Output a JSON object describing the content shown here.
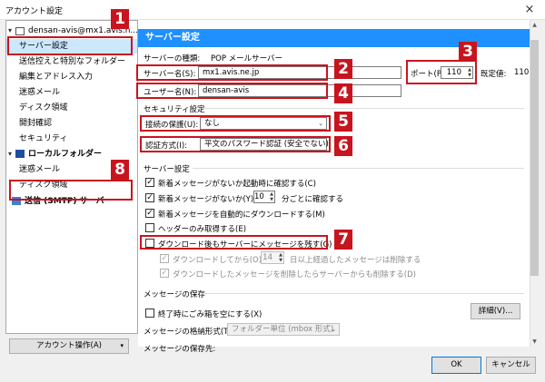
{
  "window": {
    "title": "アカウント設定",
    "close_icon": "×"
  },
  "tree": {
    "items": [
      {
        "label": "densan-avis@mx1.avis.n..."
      },
      {
        "label": "サーバー設定"
      },
      {
        "label": "送信控えと特別なフォルダー"
      },
      {
        "label": "編集とアドレス入力"
      },
      {
        "label": "迷惑メール"
      },
      {
        "label": "ディスク領域"
      },
      {
        "label": "開封確認"
      },
      {
        "label": "セキュリティ"
      },
      {
        "label": "ローカルフォルダー"
      },
      {
        "label": "迷惑メール"
      },
      {
        "label": "ディスク領域"
      },
      {
        "label": "送信 (SMTP) サーバー"
      }
    ]
  },
  "account_ops": {
    "label": "アカウント操作(A)",
    "arrow": "▾"
  },
  "header": {
    "title": "サーバー設定"
  },
  "server": {
    "type_label": "サーバーの種類:",
    "type_value": "POP メールサーバー",
    "name_label": "サーバー名(S):",
    "name_value": "mx1.avis.ne.jp",
    "port_label": "ポート(P):",
    "port_value": "110",
    "default_label": "既定値:",
    "default_value": "110",
    "user_label": "ユーザー名(N):",
    "user_value": "densan-avis"
  },
  "security": {
    "group_label": "セキュリティ設定",
    "conn_label": "接続の保護(U):",
    "conn_value": "なし",
    "auth_label": "認証方式(I):",
    "auth_value": "平文のパスワード認証 (安全でない)"
  },
  "server_settings": {
    "group_label": "サーバー設定",
    "check_startup": "新着メッセージがないか起動時に確認する(C)",
    "check_every_pre": "新着メッセージがないか(Y)",
    "check_every_value": "10",
    "check_every_post": "分ごとに確認する",
    "auto_download": "新着メッセージを自動的にダウンロードする(M)",
    "headers_only": "ヘッダーのみ取得する(E)",
    "leave_on_server": "ダウンロード後もサーバーにメッセージを残す(G)",
    "delete_after_pre": "ダウンロードしてから(O)",
    "delete_after_value": "14",
    "delete_after_post": "日以上経過したメッセージは削除する",
    "delete_when_local": "ダウンロードしたメッセージを削除したらサーバーからも削除する(D)"
  },
  "storage": {
    "group_label": "メッセージの保存",
    "empty_trash": "終了時にごみ箱を空にする(X)",
    "advanced_button": "詳細(V)...",
    "format_label": "メッセージの格納形式(T):",
    "format_value": "フォルダー単位 (mbox 形式)",
    "dest_label": "メッセージの保存先:"
  },
  "buttons": {
    "ok": "OK",
    "cancel": "キャンセル"
  },
  "annotations": [
    "1",
    "2",
    "3",
    "4",
    "5",
    "6",
    "7",
    "8"
  ],
  "colors": {
    "accent": "#1e90ff",
    "annotation": "#c8141e"
  }
}
